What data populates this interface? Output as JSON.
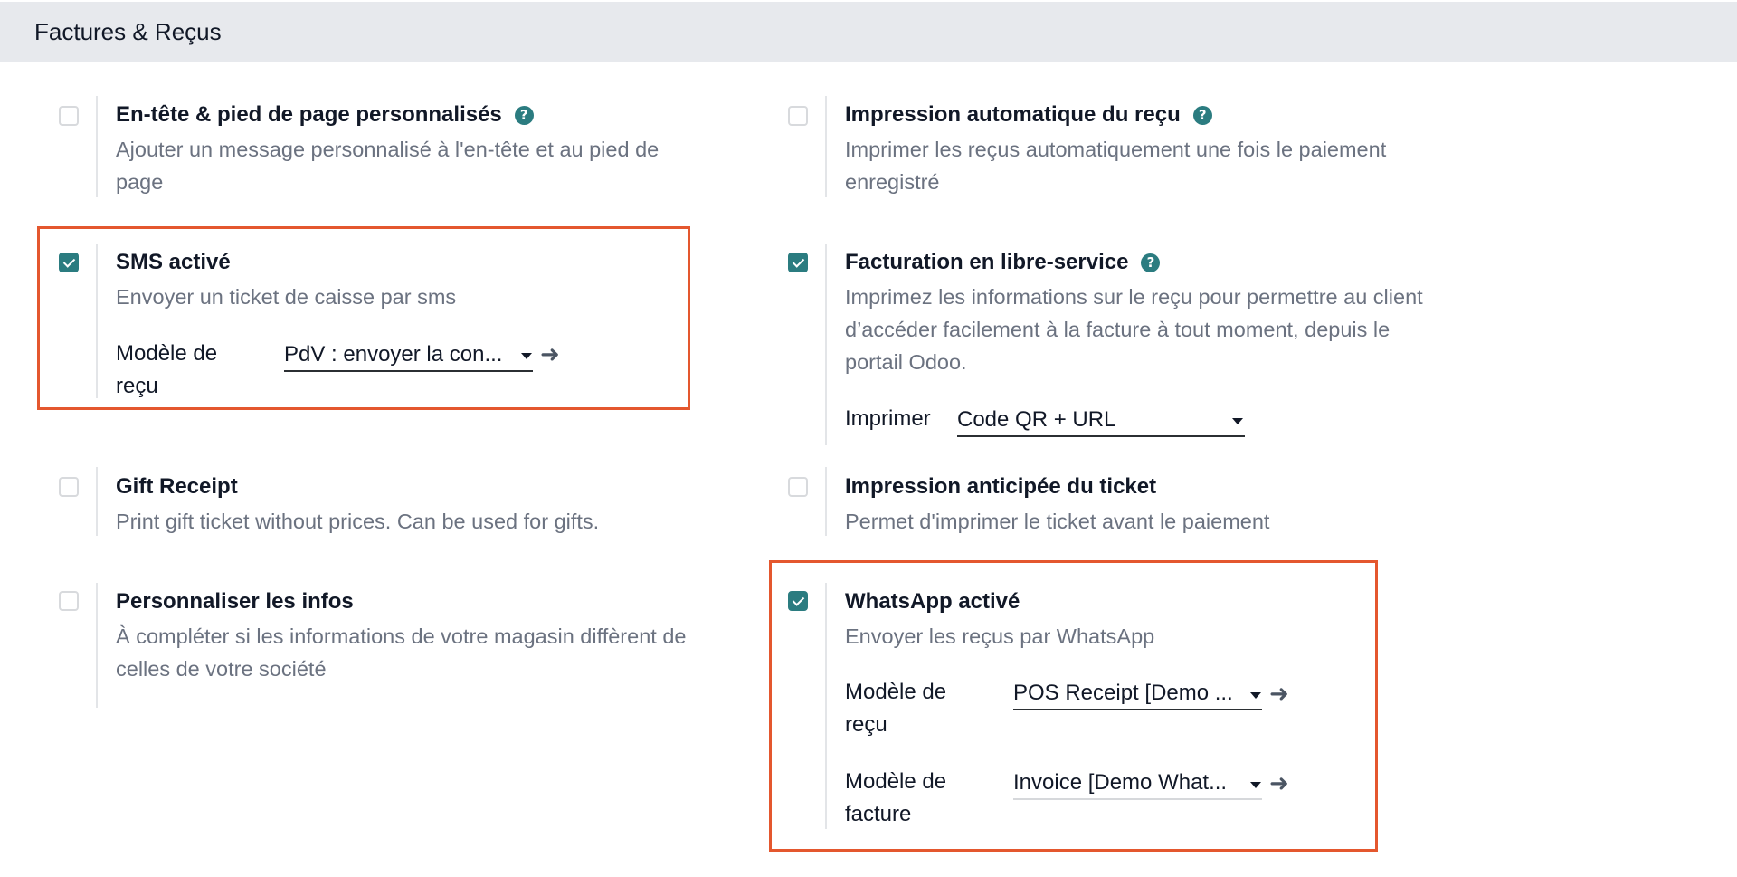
{
  "section": {
    "title": "Factures & Reçus"
  },
  "settings": {
    "custom_header": {
      "title": "En-tête & pied de page personnalisés",
      "desc_line1": "Ajouter un message personnalisé à l'en-tête et au pied de",
      "desc_line2": "page",
      "checked": false
    },
    "auto_print": {
      "title": "Impression automatique du reçu",
      "desc_line1": "Imprimer les reçus automatiquement une fois le paiement",
      "desc_line2": "enregistré",
      "checked": false
    },
    "sms": {
      "title": "SMS activé",
      "desc": "Envoyer un ticket de caisse par sms",
      "checked": true,
      "field_label_line1": "Modèle de",
      "field_label_line2": "reçu",
      "field_value": "PdV : envoyer la con..."
    },
    "self_invoicing": {
      "title": "Facturation en libre-service",
      "desc_line1": "Imprimez les informations sur le reçu pour permettre au client",
      "desc_line2": "d’accéder facilement à la facture à tout moment, depuis le",
      "desc_line3": "portail Odoo.",
      "checked": true,
      "field_label": "Imprimer",
      "field_value": "Code QR + URL"
    },
    "gift_receipt": {
      "title": "Gift Receipt",
      "desc": "Print gift ticket without prices. Can be used for gifts.",
      "checked": false
    },
    "early_print": {
      "title": "Impression anticipée du ticket",
      "desc": "Permet d'imprimer le ticket avant le paiement",
      "checked": false
    },
    "custom_info": {
      "title": "Personnaliser les infos",
      "desc_line1": "À compléter si les informations de votre magasin diffèrent de",
      "desc_line2": "celles de votre société",
      "checked": false
    },
    "whatsapp": {
      "title": "WhatsApp activé",
      "desc": "Envoyer les reçus par WhatsApp",
      "checked": true,
      "receipt_label_line1": "Modèle de",
      "receipt_label_line2": "reçu",
      "receipt_value": "POS Receipt [Demo ...",
      "invoice_label_line1": "Modèle de",
      "invoice_label_line2": "facture",
      "invoice_value": "Invoice [Demo What..."
    }
  },
  "icons": {
    "help": "question-circle-icon",
    "arrow": "arrow-right-icon",
    "caret": "caret-down-icon",
    "check": "checkmark-icon"
  },
  "colors": {
    "accent": "#2b7c80",
    "highlight": "#e4572e",
    "header_bg": "#e7e9ed"
  }
}
